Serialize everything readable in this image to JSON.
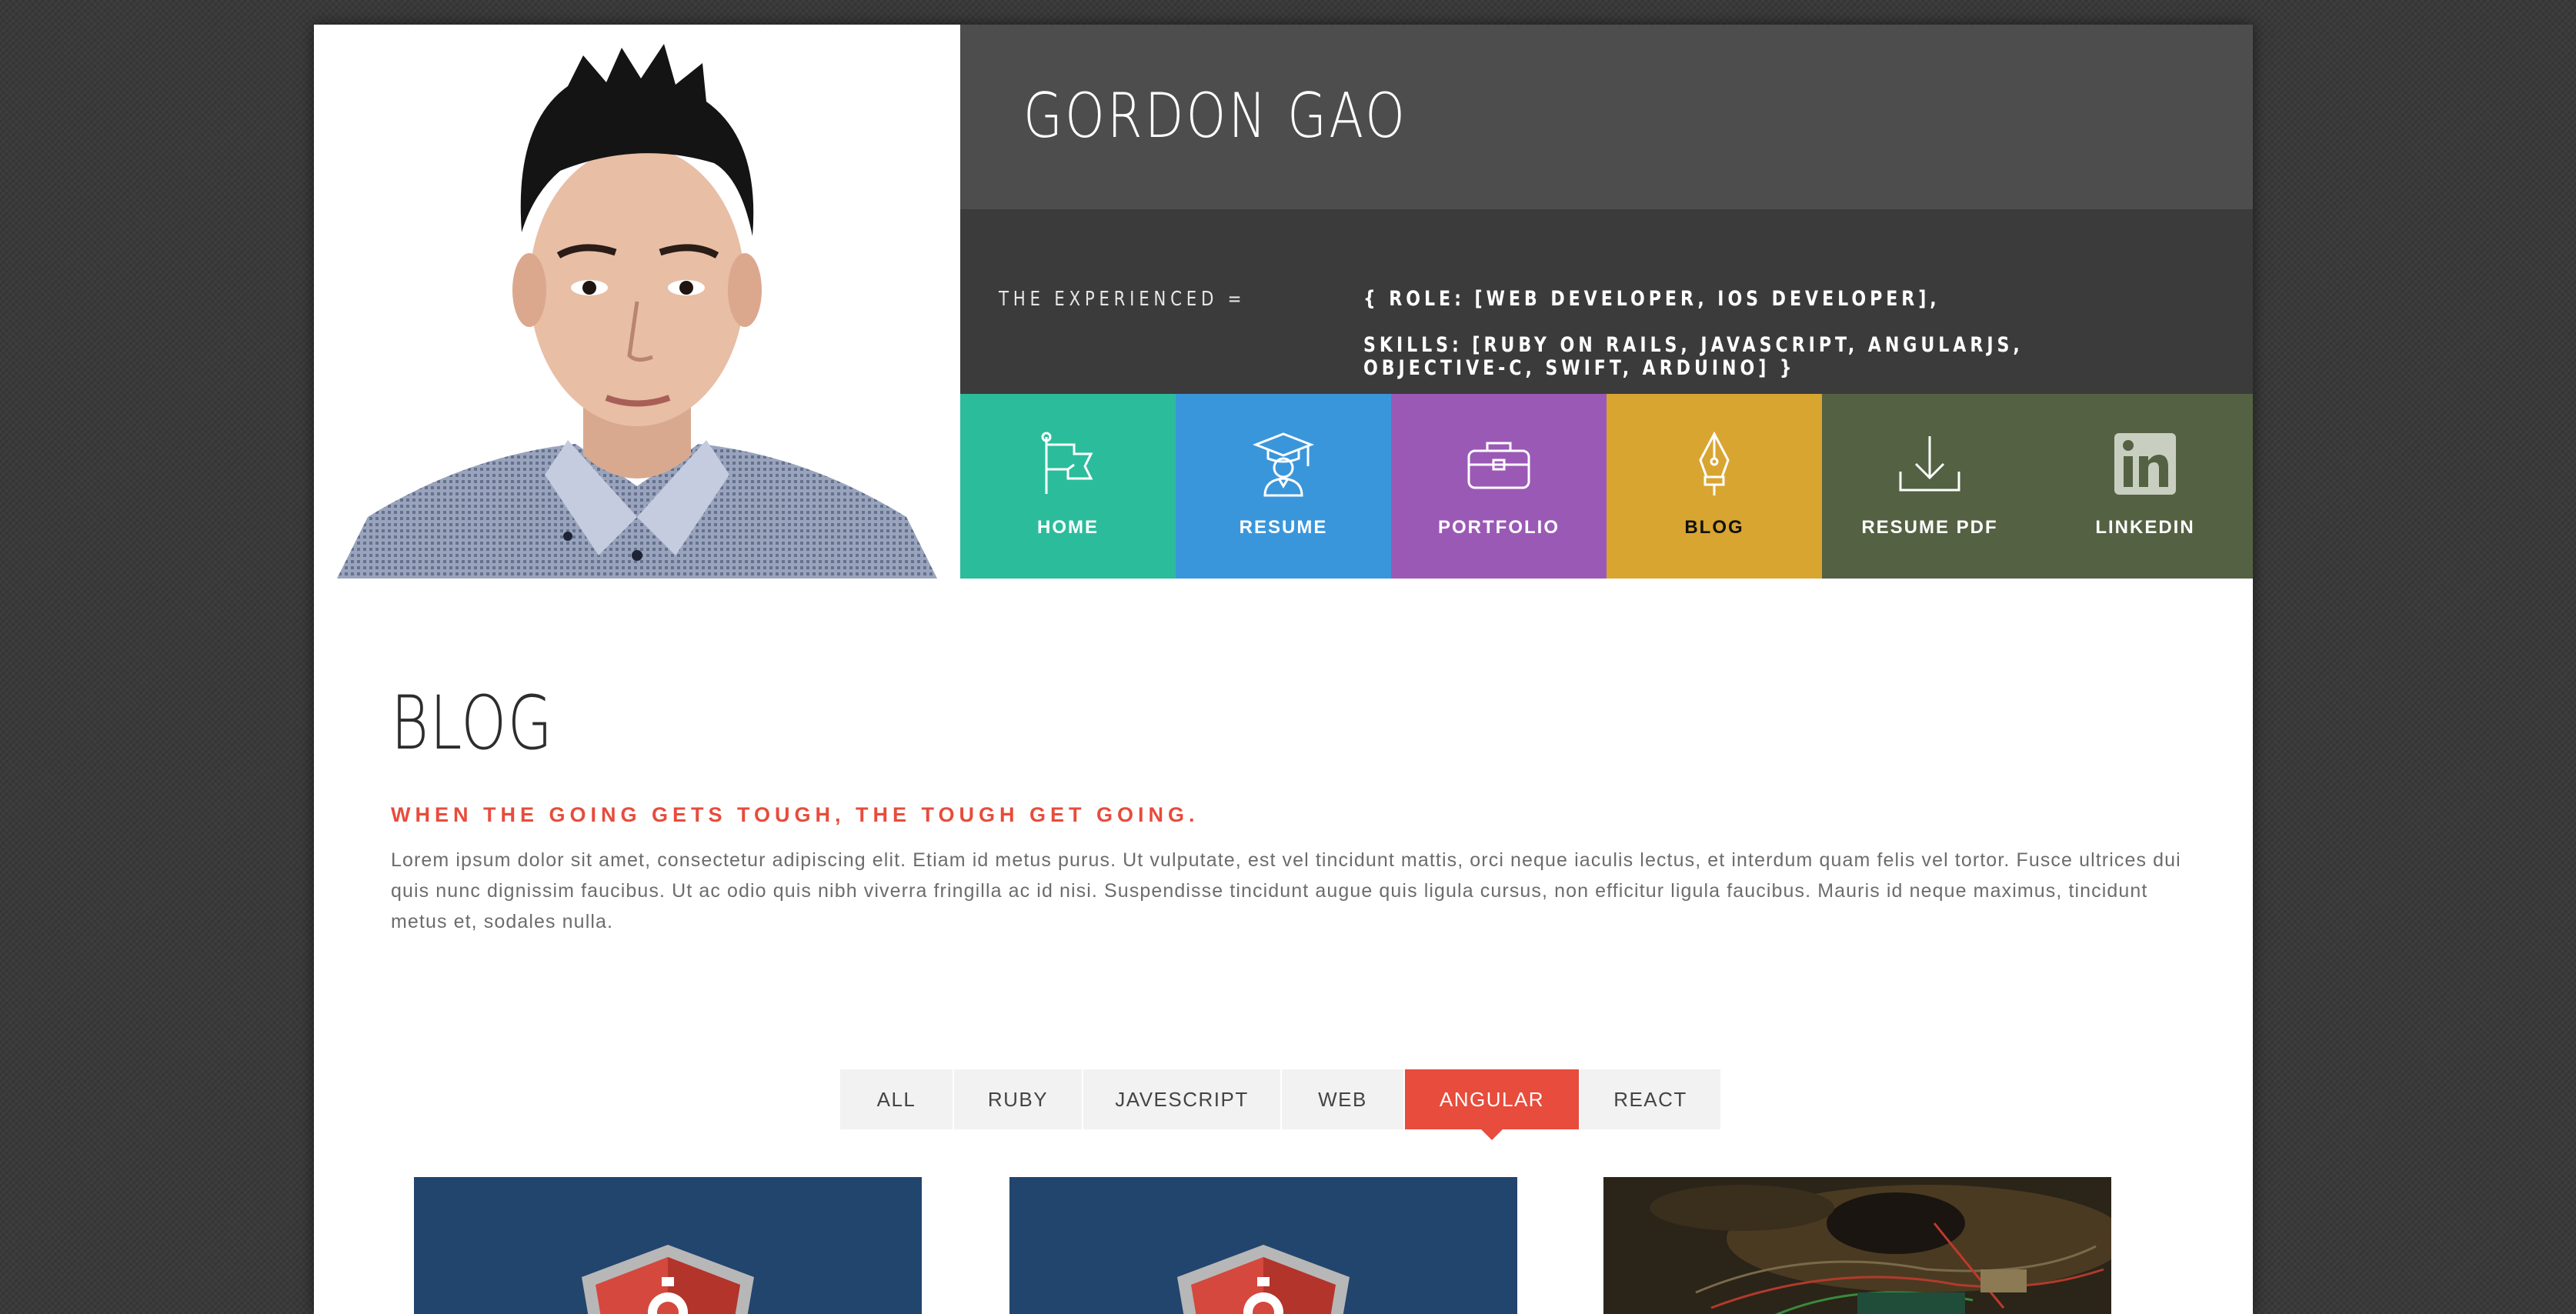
{
  "header": {
    "name": "GORDON GAO",
    "tagline_label": "THE EXPERIENCED =",
    "role_line": "{ ROLE: [WEB DEVELOPER, IOS DEVELOPER],",
    "skills_line1": "SKILLS: [RUBY ON RAILS, JAVASCRIPT, ANGULARJS,",
    "skills_line2": "OBJECTIVE-C, SWIFT, ARDUINO] }"
  },
  "nav": [
    {
      "label": "HOME",
      "icon": "flag-icon",
      "color": "#2bbc9c"
    },
    {
      "label": "RESUME",
      "icon": "graduate-icon",
      "color": "#3a96db"
    },
    {
      "label": "PORTFOLIO",
      "icon": "briefcase-icon",
      "color": "#9b59b6"
    },
    {
      "label": "BLOG",
      "icon": "pen-nib-icon",
      "color": "#d9a531",
      "active": true
    },
    {
      "label": "RESUME PDF",
      "icon": "download-icon",
      "color": "#546142"
    },
    {
      "label": "LINKEDIN",
      "icon": "linkedin-icon",
      "color": "#546142"
    }
  ],
  "blog": {
    "title": "BLOG",
    "subtitle": "WHEN THE GOING GETS TOUGH, THE TOUGH GET GOING.",
    "body": "Lorem ipsum dolor sit amet, consectetur adipiscing elit. Etiam id metus purus. Ut vulputate, est vel tincidunt mattis, orci neque iaculis lectus, et interdum quam felis vel tortor. Fusce ultrices dui quis nunc dignissim faucibus. Ut ac odio quis nibh viverra fringilla ac id nisi. Suspendisse tincidunt augue quis ligula cursus, non efficitur ligula faucibus. Mauris id neque maximus, tincidunt metus et, sodales nulla."
  },
  "filters": [
    {
      "label": "ALL"
    },
    {
      "label": "RUBY"
    },
    {
      "label": "JAVESCRIPT"
    },
    {
      "label": "WEB"
    },
    {
      "label": "ANGULAR",
      "active": true
    },
    {
      "label": "REACT"
    }
  ],
  "colors": {
    "accent_red": "#e74c3c",
    "name_bar": "#4d4d4d",
    "info_bar": "#3b3b3b"
  }
}
